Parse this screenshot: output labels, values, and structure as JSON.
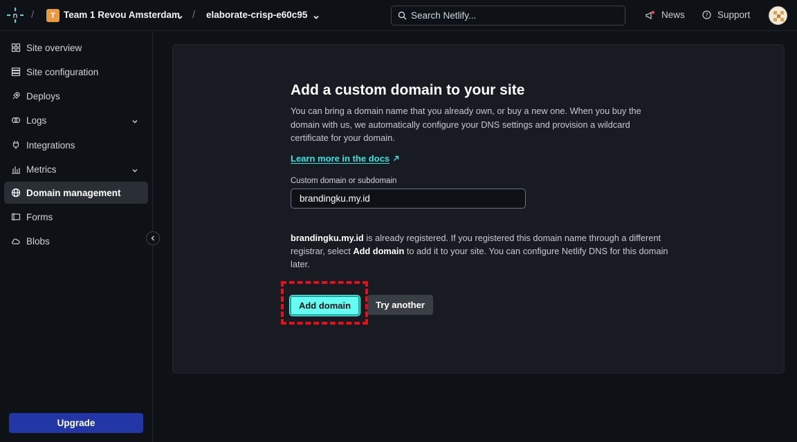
{
  "header": {
    "team_initial": "T",
    "team_name": "Team 1 Revou Amsterdam",
    "site_name": "elaborate-crisp-e60c95",
    "search_placeholder": "Search Netlify...",
    "news_label": "News",
    "support_label": "Support",
    "logo_icon": "netlify-logo-icon"
  },
  "sidebar": {
    "items": [
      {
        "label": "Site overview",
        "icon": "grid-icon"
      },
      {
        "label": "Site configuration",
        "icon": "settings-list-icon"
      },
      {
        "label": "Deploys",
        "icon": "rocket-icon"
      },
      {
        "label": "Logs",
        "icon": "logs-icon",
        "expandable": true
      },
      {
        "label": "Integrations",
        "icon": "plug-icon"
      },
      {
        "label": "Metrics",
        "icon": "bar-chart-icon",
        "expandable": true
      },
      {
        "label": "Domain management",
        "icon": "globe-icon",
        "active": true
      },
      {
        "label": "Forms",
        "icon": "form-icon"
      },
      {
        "label": "Blobs",
        "icon": "cloud-icon"
      }
    ],
    "upgrade_label": "Upgrade"
  },
  "main": {
    "title": "Add a custom domain to your site",
    "description": "You can bring a domain name that you already own, or buy a new one. When you buy the domain with us, we automatically configure your DNS settings and provision a wildcard certificate for your domain.",
    "docs_link": "Learn more in the docs",
    "field_label": "Custom domain or subdomain",
    "field_value": "brandingku.my.id",
    "notice": {
      "domain": "brandingku.my.id",
      "part1": " is already registered. If you registered this domain name through a different registrar, select ",
      "action": "Add domain",
      "part2": " to add it to your site. You can configure Netlify DNS for this domain later."
    },
    "add_button": "Add domain",
    "try_button": "Try another"
  },
  "colors": {
    "background": "#0e1217",
    "card": "#181c22",
    "accent": "#32e6e2",
    "primary_button": "#66fcf1",
    "upgrade": "#2336a6",
    "highlight": "#e0131c"
  }
}
